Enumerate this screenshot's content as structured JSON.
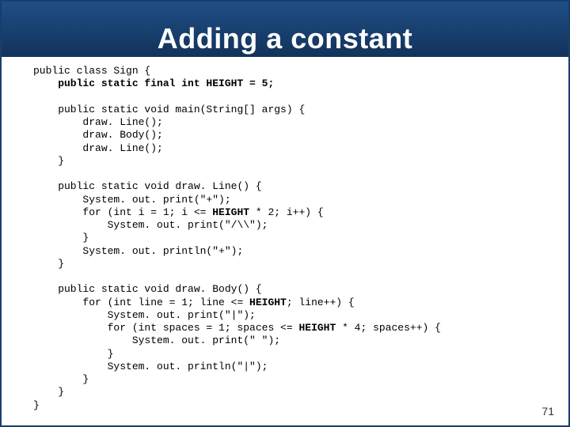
{
  "title": "Adding a constant",
  "pagenum": "71",
  "code": {
    "l01": "public class Sign {",
    "l02": "    public static final int HEIGHT = 5;",
    "l03": "",
    "l04": "    public static void main(String[] args) {",
    "l05": "        draw. Line();",
    "l06": "        draw. Body();",
    "l07": "        draw. Line();",
    "l08": "    }",
    "l09": "",
    "l10": "    public static void draw. Line() {",
    "l11": "        System. out. print(\"+\");",
    "l12a": "        for (int i = 1; i <= ",
    "l12b": "HEIGHT",
    "l12c": " * 2; i++) {",
    "l13": "            System. out. print(\"/\\\\\");",
    "l14": "        }",
    "l15": "        System. out. println(\"+\");",
    "l16": "    }",
    "l17": "",
    "l18": "    public static void draw. Body() {",
    "l19a": "        for (int line = 1; line <= ",
    "l19b": "HEIGHT",
    "l19c": "; line++) {",
    "l20": "            System. out. print(\"|\");",
    "l21a": "            for (int spaces = 1; spaces <= ",
    "l21b": "HEIGHT",
    "l21c": " * 4; spaces++) {",
    "l22": "                System. out. print(\" \");",
    "l23": "            }",
    "l24": "            System. out. println(\"|\");",
    "l25": "        }",
    "l26": "    }",
    "l27": "}"
  }
}
